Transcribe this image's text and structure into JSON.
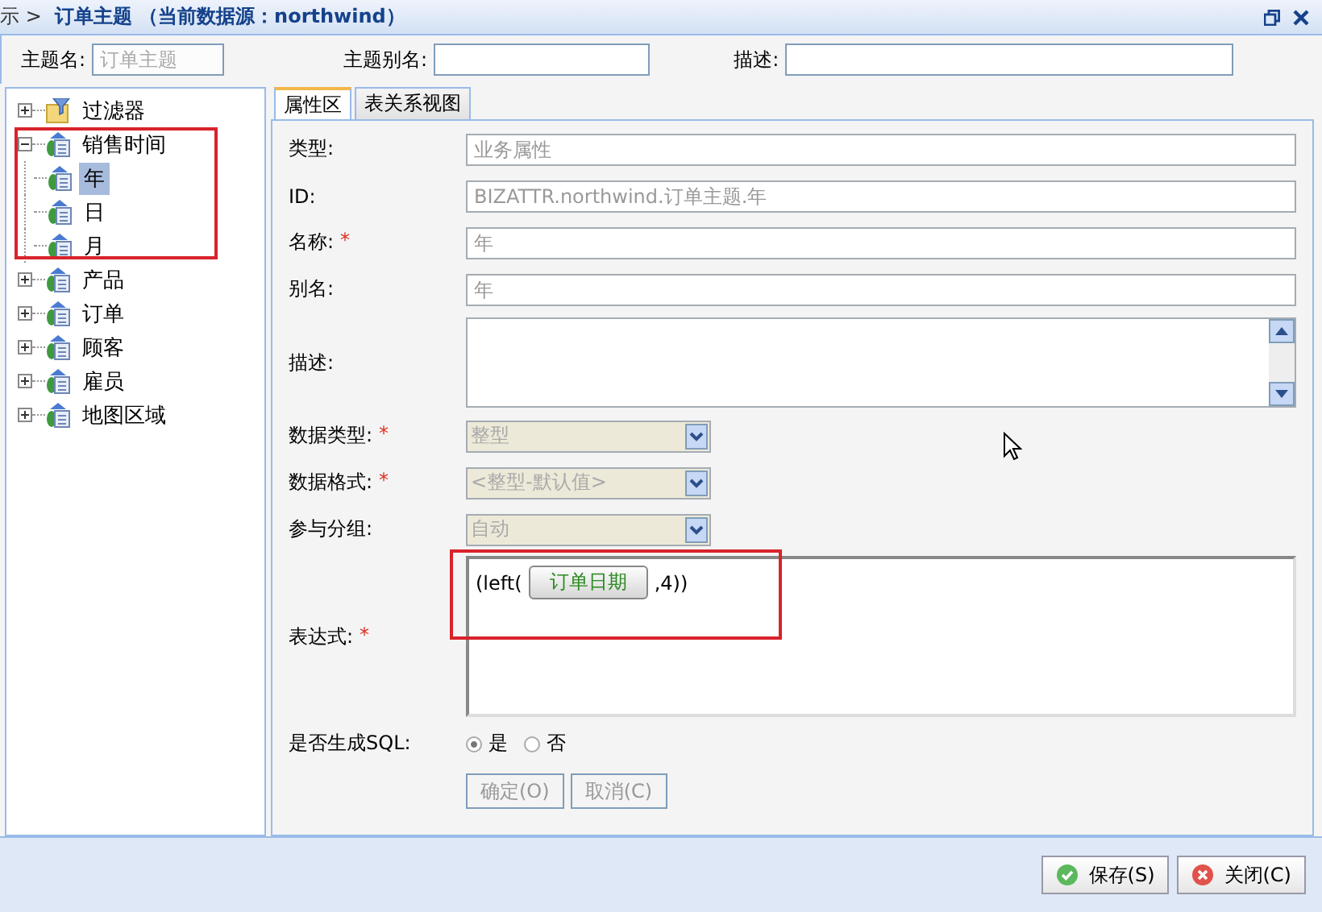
{
  "title_bar": {
    "prefix": "示 >",
    "title": "订单主题 （当前数据源：northwind）"
  },
  "header_fields": [
    {
      "label": "主题名:",
      "value": "订单主题",
      "disabled": true
    },
    {
      "label": "主题别名:"
    },
    {
      "label": "描述:"
    }
  ],
  "tree": [
    {
      "label": "过滤器",
      "kind": "filter",
      "expanded": false,
      "selected": false
    },
    {
      "label": "销售时间",
      "kind": "dimension",
      "expanded": true,
      "selected": false,
      "highlighted": true,
      "children": [
        {
          "label": "年",
          "selected": true
        },
        {
          "label": "日",
          "selected": false
        },
        {
          "label": "月",
          "selected": false
        }
      ]
    },
    {
      "label": "产品",
      "kind": "dimension",
      "expanded": false,
      "selected": false
    },
    {
      "label": "订单",
      "kind": "dimension",
      "expanded": false,
      "selected": false
    },
    {
      "label": "顾客",
      "kind": "dimension",
      "expanded": false,
      "selected": false
    },
    {
      "label": "雇员",
      "kind": "dimension",
      "expanded": false,
      "selected": false
    },
    {
      "label": "地图区域",
      "kind": "dimension",
      "expanded": false,
      "selected": false
    }
  ],
  "tabs": [
    {
      "label": "属性区",
      "selected": true
    },
    {
      "label": "表关系视图",
      "selected": false
    }
  ],
  "form_rows": [
    {
      "kind": "text",
      "label": "类型:",
      "value": "业务属性"
    },
    {
      "kind": "text",
      "label": "ID:",
      "value": "BIZATTR.northwind.订单主题.年"
    },
    {
      "kind": "text",
      "label": "名称:",
      "required_mark": "*",
      "value": "年"
    },
    {
      "kind": "text",
      "label": "别名:",
      "value": "年"
    },
    {
      "kind": "textarea",
      "label": "描述:"
    },
    {
      "kind": "select",
      "label": "数据类型:",
      "required_mark": "*",
      "value": "整型"
    },
    {
      "kind": "select",
      "label": "数据格式:",
      "required_mark": "*",
      "value": "<整型-默认值>"
    },
    {
      "kind": "select",
      "label": "参与分组:",
      "value": "自动"
    },
    {
      "kind": "expression",
      "label": "表达式:",
      "required_mark": "*",
      "prefix": "(left(",
      "token": "订单日期",
      "suffix": ",4))",
      "highlighted": true
    },
    {
      "kind": "radio",
      "label": "是否生成SQL:",
      "options": [
        {
          "label": "是",
          "selected": true
        },
        {
          "label": "否",
          "selected": false
        }
      ]
    }
  ],
  "form_buttons": [
    {
      "label": "确定(O)",
      "disabled": true
    },
    {
      "label": "取消(C)",
      "disabled": true
    }
  ],
  "footer_buttons": [
    {
      "label": "保存(S)",
      "kind": "save"
    },
    {
      "label": "关闭(C)",
      "kind": "close"
    }
  ]
}
